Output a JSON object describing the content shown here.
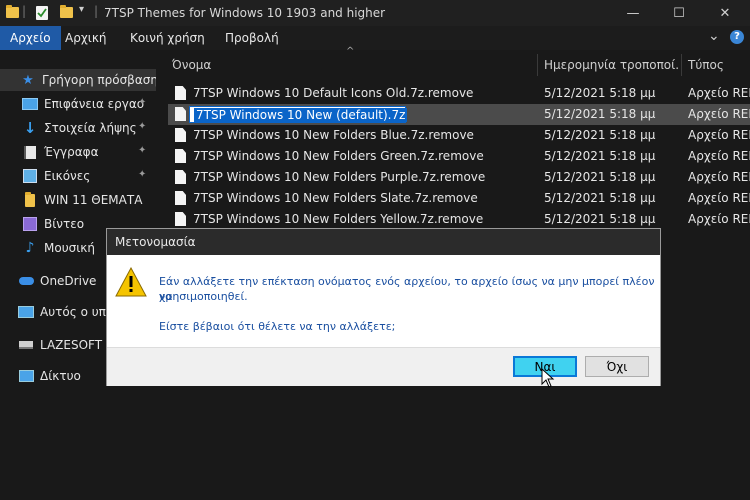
{
  "window": {
    "title": "7TSP Themes for Windows 10 1903 and higher",
    "controls": {
      "minimize": "—",
      "maximize": "☐",
      "close": "✕"
    }
  },
  "ribbon": {
    "tabs": [
      "Αρχείο",
      "Αρχική",
      "Κοινή χρήση",
      "Προβολή"
    ],
    "expand": "⌄",
    "help": "?"
  },
  "nav": {
    "items": [
      {
        "label": "Γρήγορη πρόσβαση",
        "icon": "star-icon"
      },
      {
        "label": "Επιφάνεια εργασ",
        "icon": "desktop-icon"
      },
      {
        "label": "Στοιχεία λήψης",
        "icon": "download-icon"
      },
      {
        "label": "Έγγραφα",
        "icon": "document-icon"
      },
      {
        "label": "Εικόνες",
        "icon": "pictures-icon"
      },
      {
        "label": "WIN 11 ΘΕΜΑΤΑ",
        "icon": "folder-icon"
      },
      {
        "label": "Βίντεο",
        "icon": "video-icon"
      },
      {
        "label": "Μουσική",
        "icon": "music-icon"
      },
      {
        "label": "OneDrive",
        "icon": "cloud-icon"
      },
      {
        "label": "Αυτός ο υπολ",
        "icon": "computer-icon"
      },
      {
        "label": "LAZESOFT (E",
        "icon": "drive-icon"
      },
      {
        "label": "Δίκτυο",
        "icon": "network-icon"
      }
    ],
    "pin_glyph": "📌"
  },
  "columns": {
    "name": "Όνομα",
    "date": "Ημερομηνία τροποποί...",
    "type": "Τύπος",
    "sort_glyph": "^"
  },
  "files": [
    {
      "name": "7TSP Windows 10 Default Icons Old.7z.remove",
      "date": "5/12/2021 5:18 μμ",
      "type": "Αρχείο REMOVE"
    },
    {
      "name": "7TSP Windows 10 New (default).7z",
      "date": "5/12/2021 5:18 μμ",
      "type": "Αρχείο REMOVE"
    },
    {
      "name": "7TSP Windows 10 New Folders Blue.7z.remove",
      "date": "5/12/2021 5:18 μμ",
      "type": "Αρχείο REMOVE"
    },
    {
      "name": "7TSP Windows 10 New Folders Green.7z.remove",
      "date": "5/12/2021 5:18 μμ",
      "type": "Αρχείο REMOVE"
    },
    {
      "name": "7TSP Windows 10 New Folders Purple.7z.remove",
      "date": "5/12/2021 5:18 μμ",
      "type": "Αρχείο REMOVE"
    },
    {
      "name": "7TSP Windows 10 New Folders Slate.7z.remove",
      "date": "5/12/2021 5:18 μμ",
      "type": "Αρχείο REMOVE"
    },
    {
      "name": "7TSP Windows 10 New Folders Yellow.7z.remove",
      "date": "5/12/2021 5:18 μμ",
      "type": "Αρχείο REMOVE"
    }
  ],
  "dialog": {
    "title": "Μετονομασία",
    "message_line1": "Εάν αλλάξετε την επέκταση ονόματος ενός αρχείου, το αρχείο ίσως να μην μπορεί πλέον να",
    "message_line2": "χρησιμοποιηθεί.",
    "question": "Είστε βέβαιοι ότι θέλετε να την αλλάξετε;",
    "yes_label": "Ναι",
    "no_label": "Όχι"
  },
  "colors": {
    "accent": "#1f5aa6",
    "warning": "#f5c400",
    "yes_button": "#40d2f0"
  }
}
